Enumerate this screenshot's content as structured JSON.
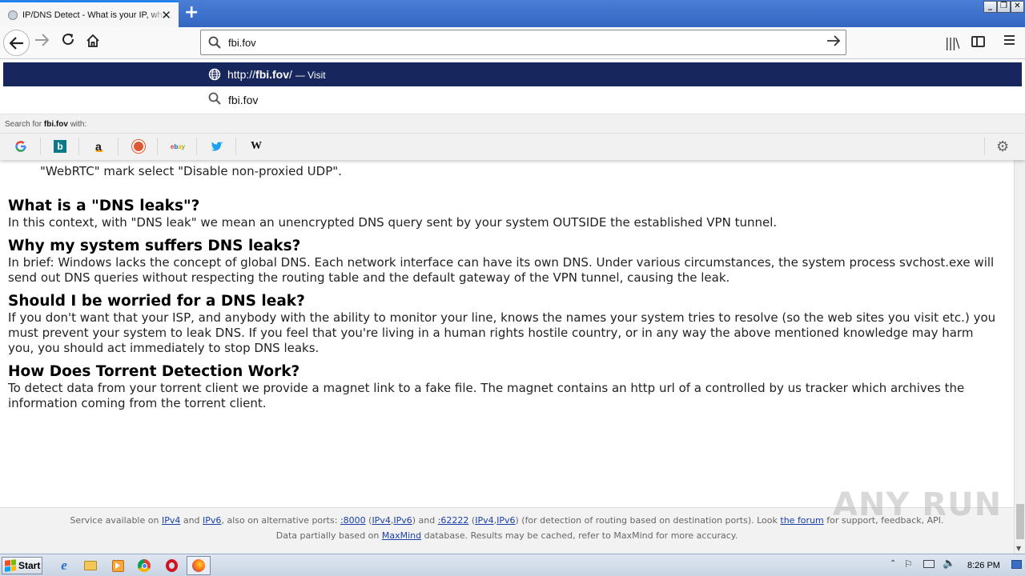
{
  "browser": {
    "tab_title": "IP/DNS Detect - What is your IP, what is your DNS, what informations you send to websites.",
    "url_value": "fbi.fov"
  },
  "url_popup": {
    "suggestion_prefix": "http://",
    "suggestion_host": "fbi.fov",
    "suggestion_suffix": "/",
    "suggestion_action": "— Visit",
    "search_item": "fbi.fov",
    "search_for_prefix": "Search for ",
    "search_for_term": "fbi.fov",
    "search_for_suffix": " with:",
    "engines": [
      "google-icon",
      "bing-icon",
      "amazon-icon",
      "duckduckgo-icon",
      "ebay-icon",
      "twitter-icon",
      "wikipedia-icon"
    ]
  },
  "content": {
    "partial_line": "\"WebRTC\" mark select \"Disable non-proxied UDP\".",
    "sections": [
      {
        "heading": "What is a \"DNS leaks\"?",
        "body": "In this context, with \"DNS leak\" we mean an unencrypted DNS query sent by your system OUTSIDE the established VPN tunnel."
      },
      {
        "heading": "Why my system suffers DNS leaks?",
        "body": "In brief: Windows lacks the concept of global DNS. Each network interface can have its own DNS. Under various circumstances, the system process svchost.exe will send out DNS queries without respecting the routing table and the default gateway of the VPN tunnel, causing the leak."
      },
      {
        "heading": "Should I be worried for a DNS leak?",
        "body": "If you don't want that your ISP, and anybody with the ability to monitor your line, knows the names your system tries to resolve (so the web sites you visit etc.) you must prevent your system to leak DNS. If you feel that you're living in a human rights hostile country, or in any way the above mentioned knowledge may harm you, you should act immediately to stop DNS leaks."
      },
      {
        "heading": "How Does Torrent Detection Work?",
        "body": "To detect data from your torrent client we provide a magnet link to a fake file. The magnet contains an http url of a controlled by us tracker which archives the information coming from the torrent client."
      }
    ]
  },
  "footer": {
    "t1": "Service available on ",
    "ipv4": "IPv4",
    "t2": " and ",
    "ipv6": "IPv6",
    "t3": ", also on alternative ports: ",
    "port1": ":8000",
    "t4": " (",
    "p1_ipv4": "IPv4",
    "comma": ",",
    "p1_ipv6": "IPv6",
    "t5": ") and ",
    "port2": ":62222",
    "t6": " (",
    "p2_ipv4": "IPv4",
    "p2_ipv6": "IPv6",
    "t7": ") (for detection of routing based on destination ports). Look ",
    "forum": "the forum",
    "t8": " for support, feedback, API.",
    "l2_a": "Data partially based on ",
    "maxmind": "MaxMind",
    "l2_b": " database. Results may be cached, refer to MaxMind for more accuracy."
  },
  "watermark": "ANY RUN",
  "taskbar": {
    "start_label": "Start",
    "clock": "8:26 PM",
    "apps": [
      "ie-icon",
      "explorer-icon",
      "media-player-icon",
      "chrome-icon",
      "opera-icon",
      "firefox-icon"
    ]
  },
  "colors": {
    "selected_row": "#17275e",
    "titlebar": "#3266c2",
    "link": "#1a3fa8"
  }
}
